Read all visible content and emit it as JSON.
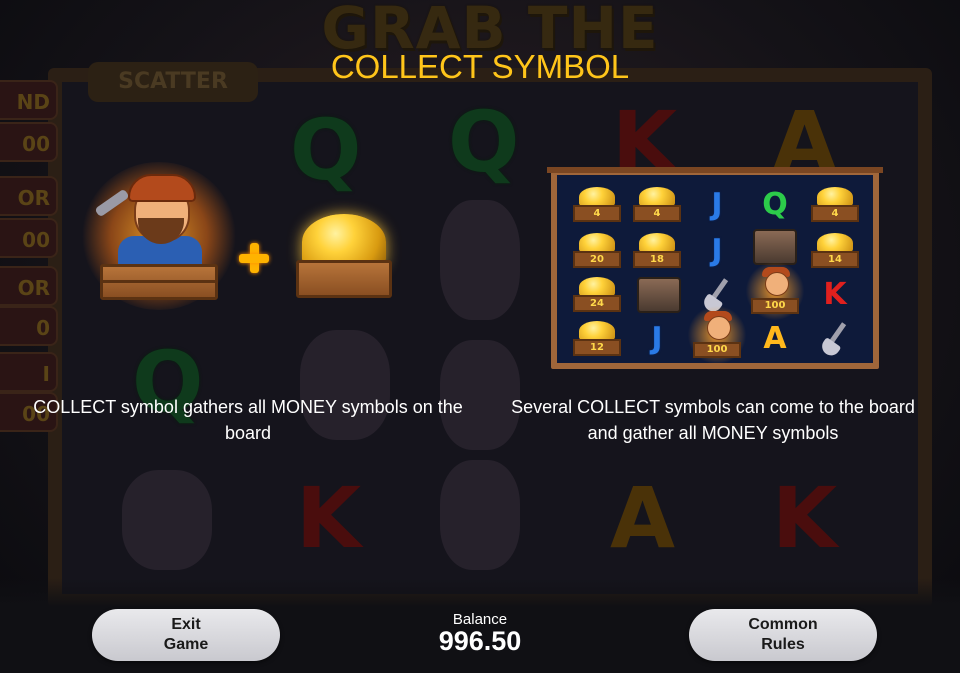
{
  "background": {
    "game_title": "GRAB THE GOLD!",
    "scatter_label": "SCATTER",
    "jackpots": [
      "ND",
      "00",
      "OR",
      "00",
      "OR",
      "0",
      "I",
      "00"
    ]
  },
  "title": "COLLECT SYMBOL",
  "left_caption": "COLLECT symbol gathers all MONEY symbols on the board",
  "right_caption": "Several COLLECT symbols can come to the board and gather all MONEY symbols",
  "example_board": {
    "money_values": [
      "4",
      "4",
      "4",
      "20",
      "18",
      "14",
      "24",
      "12"
    ],
    "collect_values": [
      "100",
      "100"
    ],
    "letters": [
      "J",
      "Q",
      "J",
      "K",
      "J",
      "A"
    ]
  },
  "buttons": {
    "exit": "Exit\nGame",
    "rules": "Common\nRules"
  },
  "balance": {
    "label": "Balance",
    "value": "996.50"
  },
  "icons": [
    "plus-icon",
    "collect-miner-icon",
    "money-gold-icon",
    "shovel-icon",
    "chest-icon"
  ],
  "colors": {
    "title": "#ffc51a",
    "text": "#ffffff",
    "button": "#e0e0e4"
  }
}
